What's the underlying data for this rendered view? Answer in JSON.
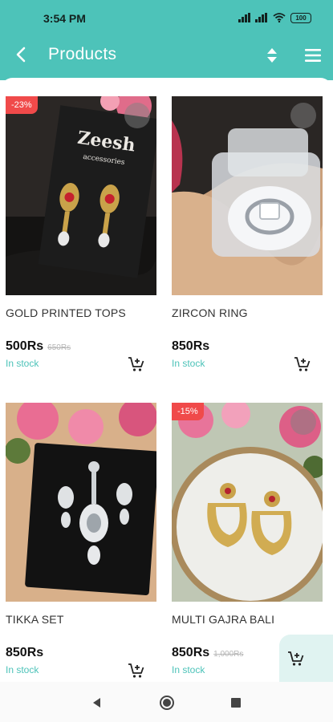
{
  "status_bar": {
    "time": "3:54 PM",
    "battery": "100"
  },
  "header": {
    "title": "Products"
  },
  "products": [
    {
      "name": "GOLD PRINTED TOPS",
      "price": "500Rs",
      "old_price": "650Rs",
      "discount": "-23%",
      "stock": "In stock",
      "image_text": "Zeesh",
      "image_subtext": "accessories"
    },
    {
      "name": "ZIRCON RING",
      "price": "850Rs",
      "old_price": "",
      "discount": "",
      "stock": "In stock"
    },
    {
      "name": "TIKKA SET",
      "price": "850Rs",
      "old_price": "",
      "discount": "",
      "stock": "In stock"
    },
    {
      "name": "MULTI GAJRA BALI",
      "price": "850Rs",
      "old_price": "1,000Rs",
      "discount": "-15%",
      "stock": "In stock"
    }
  ],
  "colors": {
    "primary": "#4dc3b9",
    "badge": "#f04a4a",
    "stock": "#4dc3b9"
  },
  "icons": [
    "back-arrow-icon",
    "sort-icon",
    "menu-icon",
    "add-to-cart-icon",
    "nav-back-icon",
    "nav-home-icon",
    "nav-recents-icon"
  ]
}
